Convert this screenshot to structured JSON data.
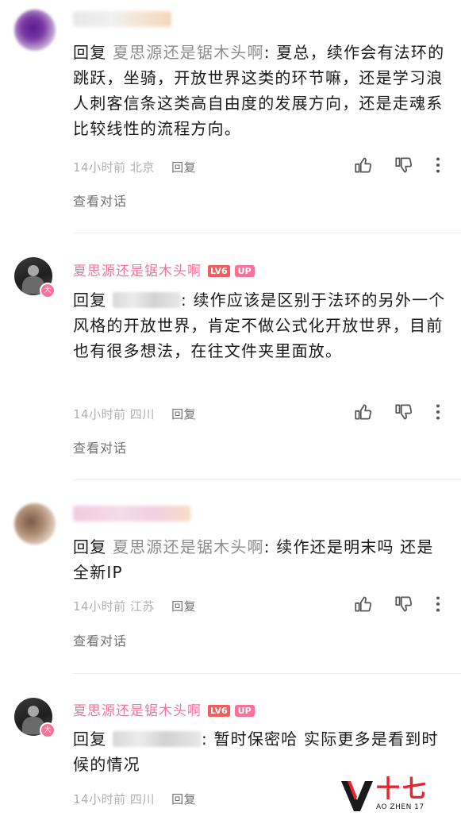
{
  "comments": [
    {
      "reply_prefix": "回复",
      "reply_target": "夏思源还是锯木头啊",
      "text": ": 夏总，续作会有法环的跳跃，坐骑，开放世界这类的环节嘛，还是学习浪人刺客信条这类高自由度的发展方向，还是走魂系比较线性的流程方向。",
      "meta": "14小时前 北京",
      "reply_label": "回复",
      "view_conversation": "查看对话"
    },
    {
      "username": "夏思源还是锯木头啊",
      "level_badge": "LV6",
      "up_badge": "UP",
      "avatar_badge": "大",
      "reply_prefix": "回复",
      "text": ": 续作应该是区别于法环的另外一个风格的开放世界，肯定不做公式化开放世界，目前也有很多想法，在往文件夹里面放。",
      "meta": "14小时前 四川",
      "reply_label": "回复",
      "view_conversation": "查看对话"
    },
    {
      "reply_prefix": "回复",
      "reply_target": "夏思源还是锯木头啊",
      "text": ": 续作还是明末吗 还是全新IP",
      "meta": "14小时前 江苏",
      "reply_label": "回复",
      "view_conversation": "查看对话"
    },
    {
      "username": "夏思源还是锯木头啊",
      "level_badge": "LV6",
      "up_badge": "UP",
      "avatar_badge": "大",
      "reply_prefix": "回复",
      "text": ": 暂时保密哈  实际更多是看到时候的情况",
      "meta": "14小时前 四川",
      "reply_label": "回复"
    }
  ],
  "watermark": {
    "logo_text": "十七",
    "sub_text": "AO ZHEN 17"
  },
  "icons": [
    "thumbs-up-icon",
    "thumbs-down-icon",
    "more-vertical-icon"
  ],
  "colors": {
    "up_pink": "#fb7299",
    "level_red": "#f25d5d",
    "muted_gray": "#8e8e8e"
  }
}
